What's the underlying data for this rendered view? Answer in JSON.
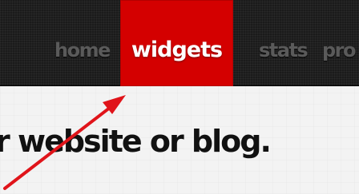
{
  "nav": {
    "items": [
      {
        "label": "home"
      },
      {
        "label": "widgets",
        "active": true
      },
      {
        "label": "stats"
      },
      {
        "label": "pro"
      }
    ],
    "active_color": "#d40000"
  },
  "content": {
    "headline": "r website or blog."
  },
  "annotation": {
    "arrow_color": "#e0141a",
    "icon": "arrow-pointer-icon"
  }
}
